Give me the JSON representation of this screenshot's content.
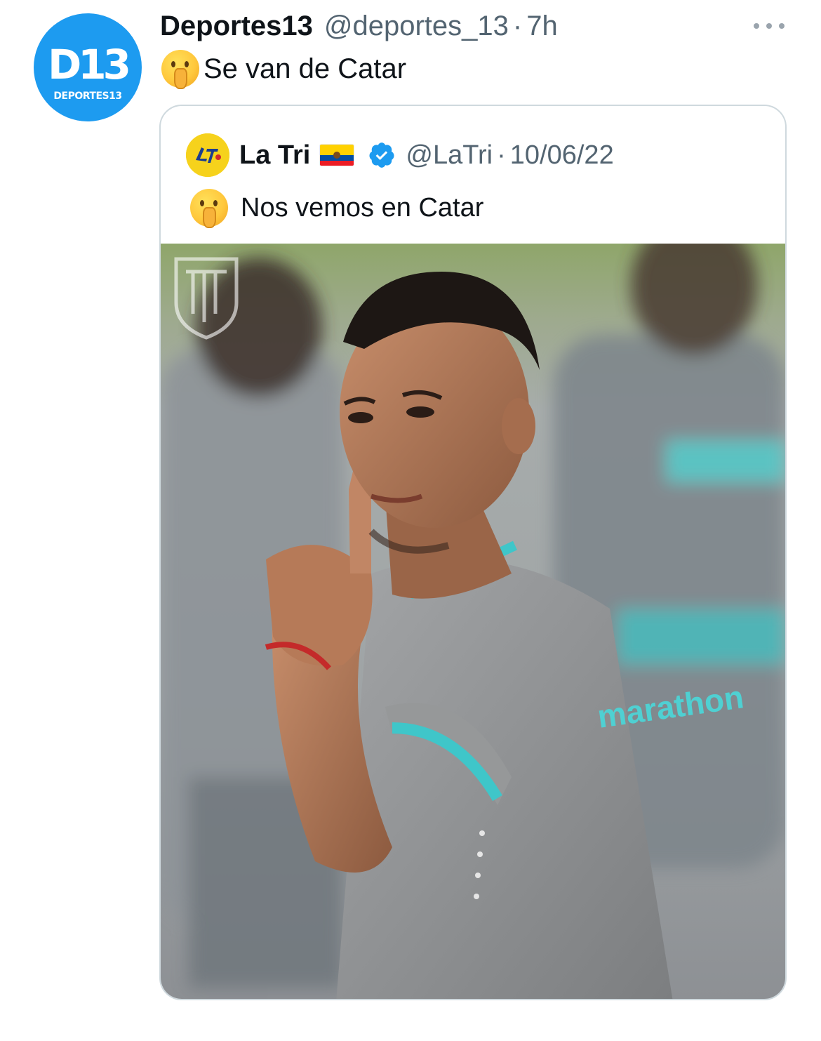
{
  "tweet": {
    "author": {
      "display_name": "Deportes13",
      "handle": "@deportes_13",
      "avatar_text_large": "D13",
      "avatar_text_small": "DEPORTES13"
    },
    "separator": "·",
    "time": "7h",
    "text": "Se van de Catar",
    "text_emoji": "shushing-face-icon",
    "more_icon": "more-horizontal-icon"
  },
  "quote": {
    "author": {
      "display_name": "La Tri",
      "handle": "@LaTri",
      "flag": "ecuador-flag-icon",
      "verified": true
    },
    "separator": "·",
    "date": "10/06/22",
    "text": "Nos vemos en Catar",
    "text_emoji": "shushing-face-icon",
    "media": {
      "description": "Player in grey training shirt making a shushing gesture",
      "shirt_text": "marathon",
      "crest": "ecuador-federation-crest"
    }
  },
  "colors": {
    "text_primary": "#0f1419",
    "text_secondary": "#536471",
    "accent": "#1d9bf0",
    "border": "#cfd9de",
    "shirt": "#8e9092",
    "trim": "#3fc6c9"
  }
}
